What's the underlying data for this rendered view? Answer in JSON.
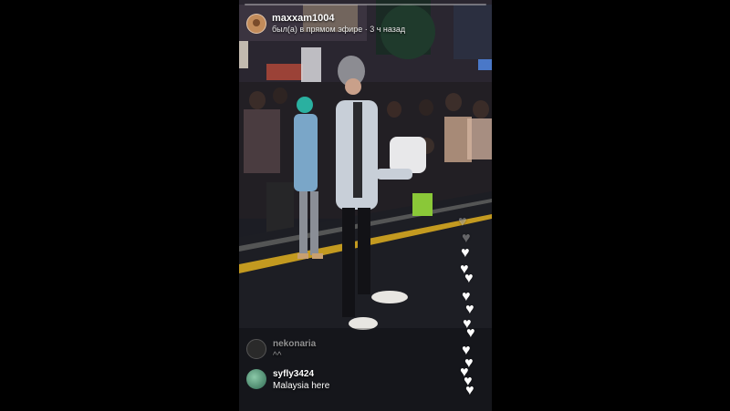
{
  "live": {
    "username": "maxxam1004",
    "status": "был(а) в прямом эфире · 3 ч назад"
  },
  "comments": [
    {
      "user": "nekonaria",
      "message": "^^",
      "faded": true
    },
    {
      "user": "syfly3424",
      "message": "Malaysia here",
      "faded": false
    }
  ],
  "reactions": {
    "icon": "heart-icon",
    "color": "#ffffff",
    "count": 14
  },
  "colors": {
    "background": "#000000",
    "street": "#1b1c22",
    "text": "#ffffff"
  }
}
